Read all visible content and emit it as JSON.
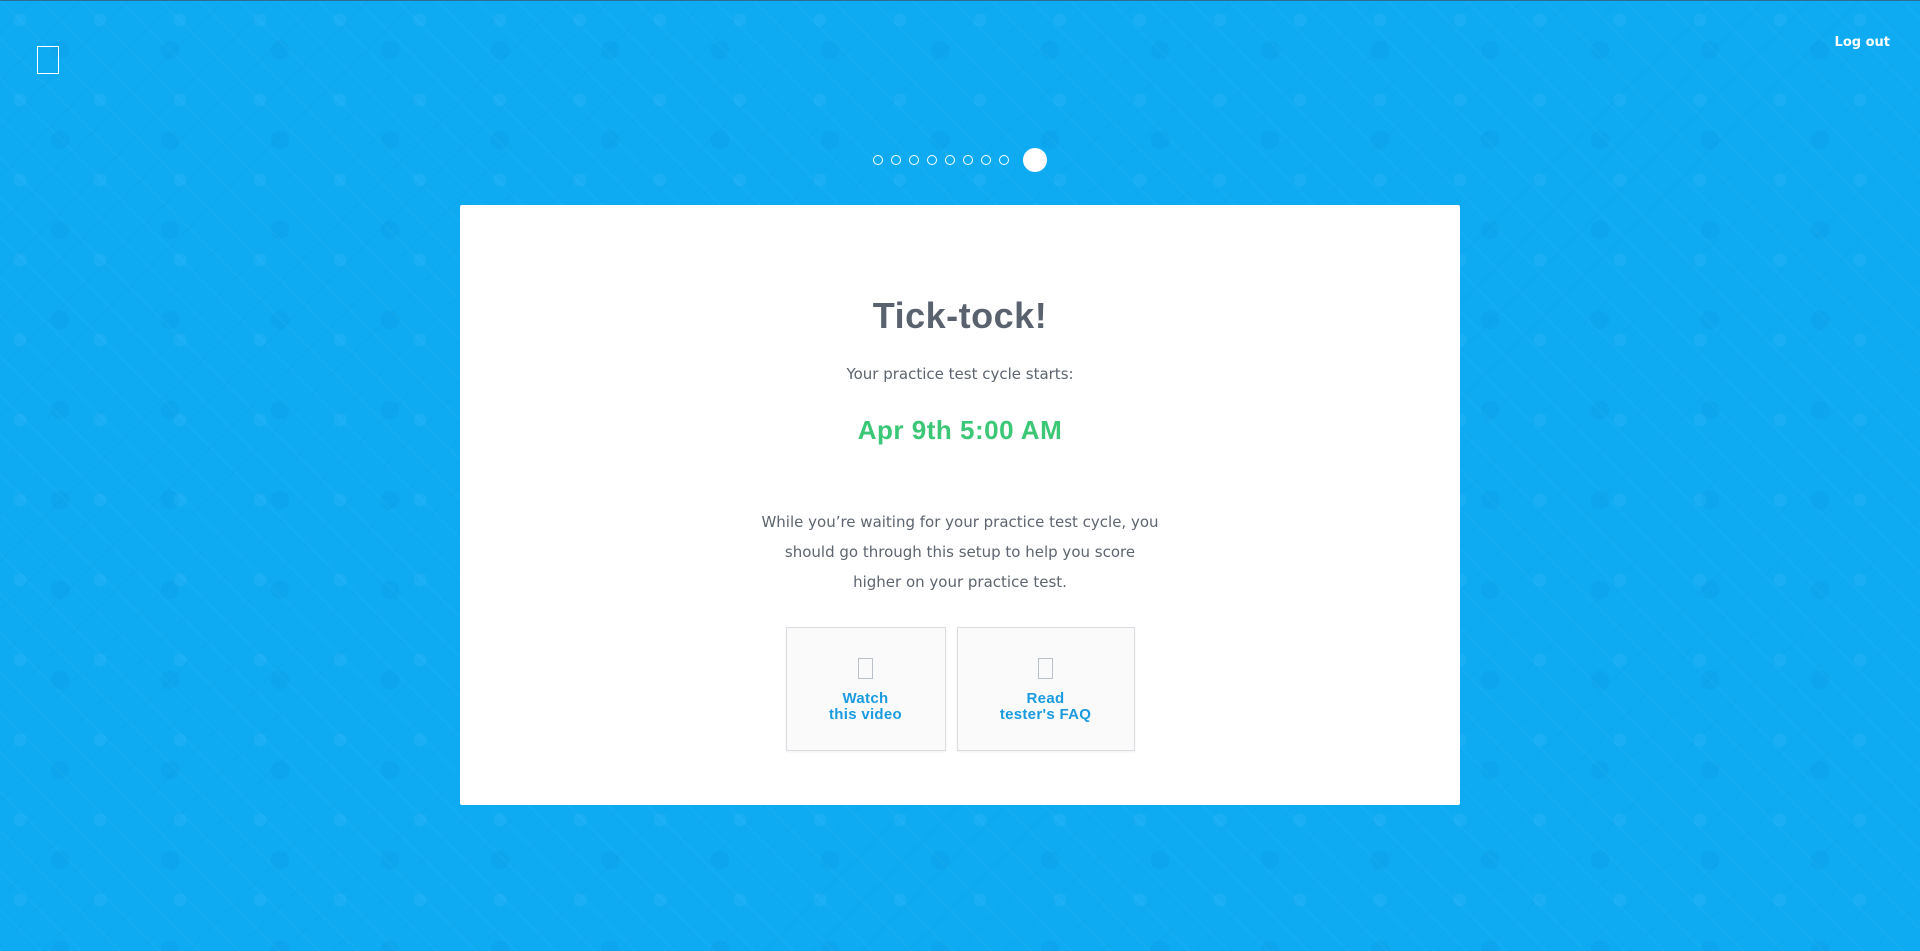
{
  "header": {
    "logout_label": "Log out"
  },
  "progress": {
    "total_steps": 9,
    "current_step": 9
  },
  "card": {
    "title": "Tick-tock!",
    "subtitle": "Your practice test cycle starts:",
    "start_datetime": "Apr 9th 5:00 AM",
    "body": "While you’re waiting for your practice test cycle, you should go through this setup to help you score higher on your practice test."
  },
  "actions": [
    {
      "line1": "Watch",
      "line2": "this video",
      "icon": "video-icon"
    },
    {
      "line1": "Read",
      "line2": "tester's FAQ",
      "icon": "faq-icon"
    }
  ],
  "colors": {
    "background": "#0eabf3",
    "title": "#59626e",
    "date": "#3cc776",
    "link": "#1a9be0"
  }
}
